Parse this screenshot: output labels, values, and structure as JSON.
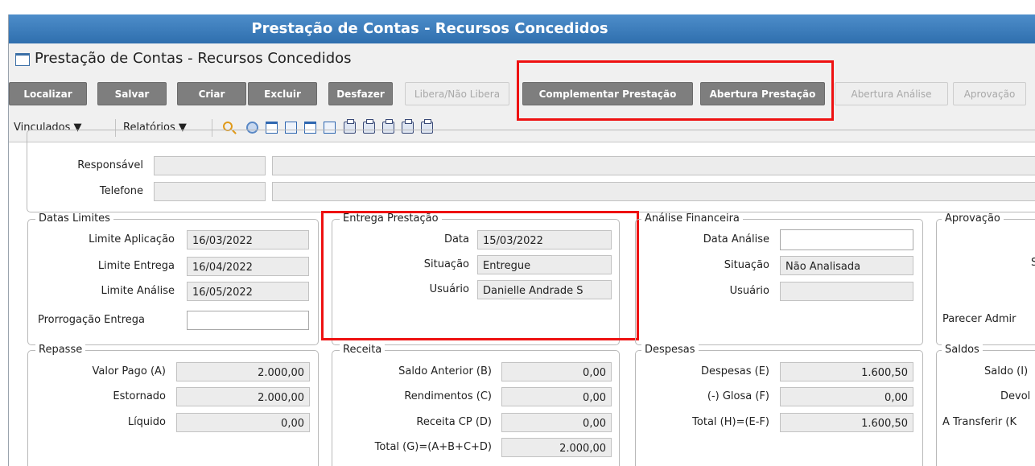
{
  "window": {
    "title": "Prestação de Contas - Recursos Concedidos"
  },
  "form": {
    "title": "Prestação de Contas - Recursos Concedidos"
  },
  "toolbar": {
    "buttons": [
      "Localizar",
      "Salvar",
      "Criar",
      "Excluir",
      "Desfazer",
      "Libera/Não Libera",
      "Complementar Prestação",
      "Abertura Prestação",
      "Abertura Análise",
      "Aprovação"
    ]
  },
  "menubar": {
    "vinculados": "Vinculados ▼",
    "relatorios": "Relatórios ▼"
  },
  "contact": {
    "responsavel_label": "Responsável",
    "telefone_label": "Telefone"
  },
  "datas_limites": {
    "title": "Datas Limites",
    "limite_aplicacao_label": "Limite Aplicação",
    "limite_aplicacao": "16/03/2022",
    "limite_entrega_label": "Limite Entrega",
    "limite_entrega": "16/04/2022",
    "limite_analise_label": "Limite Análise",
    "limite_analise": "16/05/2022",
    "prorrogacao_label": "Prorrogação Entrega",
    "prorrogacao": ""
  },
  "entrega": {
    "title": "Entrega Prestação",
    "data_label": "Data",
    "data": "15/03/2022",
    "situacao_label": "Situação",
    "situacao": "Entregue",
    "usuario_label": "Usuário",
    "usuario": "Danielle Andrade S"
  },
  "analise": {
    "title": "Análise Financeira",
    "data_label": "Data Análise",
    "data": "",
    "situacao_label": "Situação",
    "situacao": "Não Analisada",
    "usuario_label": "Usuário",
    "usuario": ""
  },
  "aprovacao": {
    "title": "Aprovação",
    "parecer_label": "Parecer Admir",
    "partial": "S"
  },
  "repasse": {
    "title": "Repasse",
    "valor_pago_label": "Valor Pago (A)",
    "valor_pago": "2.000,00",
    "estornado_label": "Estornado",
    "estornado": "2.000,00",
    "liquido_label": "Líquido",
    "liquido": "0,00"
  },
  "receita": {
    "title": "Receita",
    "saldo_anterior_label": "Saldo Anterior (B)",
    "saldo_anterior": "0,00",
    "rendimentos_label": "Rendimentos (C)",
    "rendimentos": "0,00",
    "receita_cp_label": "Receita CP (D)",
    "receita_cp": "0,00",
    "total_label": "Total (G)=(A+B+C+D)",
    "total": "2.000,00"
  },
  "despesas": {
    "title": "Despesas",
    "despesas_label": "Despesas (E)",
    "despesas": "1.600,50",
    "glosa_label": "(-) Glosa (F)",
    "glosa": "0,00",
    "total_label": "Total (H)=(E-F)",
    "total": "1.600,50"
  },
  "saldos": {
    "title": "Saldos",
    "saldo_label": "Saldo (I)",
    "devol_label": "Devol",
    "a_transferir_label": "A Transferir (K"
  }
}
